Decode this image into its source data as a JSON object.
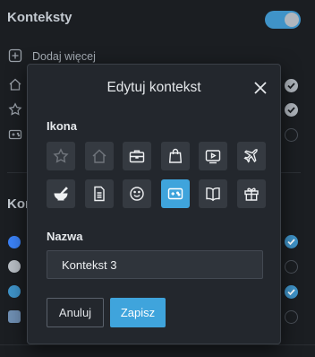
{
  "background": {
    "title": "Konteksty",
    "toggle_on": true,
    "add_more_label": "Dodaj więcej",
    "section_two_title_partial": "Kon",
    "accent_color": "#3f93c8",
    "apps": [
      {
        "icon": "messenger-icon",
        "color": "#3b82f6"
      },
      {
        "icon": "whatsapp-icon",
        "color": "#b8bec5"
      },
      {
        "icon": "telegram-icon",
        "color": "#3f93c8"
      },
      {
        "icon": "vk-icon",
        "color": "#6f8fb3"
      }
    ]
  },
  "modal": {
    "title": "Edytuj kontekst",
    "icon_section_label": "Ikona",
    "icons": [
      {
        "name": "star-icon",
        "state": "dim"
      },
      {
        "name": "home-icon",
        "state": "dim"
      },
      {
        "name": "briefcase-icon",
        "state": "normal"
      },
      {
        "name": "shopping-bag-icon",
        "state": "normal"
      },
      {
        "name": "video-player-icon",
        "state": "normal"
      },
      {
        "name": "airplane-icon",
        "state": "normal"
      },
      {
        "name": "mortar-pestle-icon",
        "state": "normal"
      },
      {
        "name": "document-icon",
        "state": "normal"
      },
      {
        "name": "smiley-icon",
        "state": "normal"
      },
      {
        "name": "gamepad-icon",
        "state": "selected"
      },
      {
        "name": "book-icon",
        "state": "normal"
      },
      {
        "name": "gift-icon",
        "state": "normal"
      }
    ],
    "name_section_label": "Nazwa",
    "name_value": "Kontekst 3",
    "cancel_label": "Anuluj",
    "save_label": "Zapisz",
    "selected_color": "#3fa4dc"
  }
}
